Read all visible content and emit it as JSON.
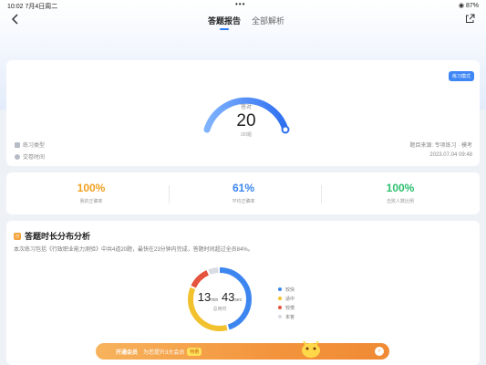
{
  "status_bar": {
    "time": "10:02",
    "date": "7月4日周二",
    "dots": "•••",
    "right": "◉ 87%"
  },
  "nav": {
    "back_icon": "chevron-left",
    "share_icon": "share",
    "tabs": [
      {
        "label": "答题报告",
        "active": true
      },
      {
        "label": "全部解析",
        "active": false
      }
    ]
  },
  "summary": {
    "tag": "练习模式",
    "gauge_label": "答对",
    "correct": "20",
    "total_text": "/20题",
    "fraction_correct": 1.0,
    "meta": {
      "type_label": "练习类型",
      "time_label": "交卷时间",
      "right_top": "题目来源: 专项练习 · 模考",
      "right_bottom": "2023.07.04 09:48"
    }
  },
  "stats": [
    {
      "value": "100%",
      "label": "我的正确率",
      "color": "#f0a020"
    },
    {
      "value": "61%",
      "label": "平均正确率",
      "color": "#3d86f0"
    },
    {
      "value": "100%",
      "label": "击败人数比例",
      "color": "#2cbf6f"
    }
  ],
  "time_analysis": {
    "title": "答题时长分布分析",
    "description": "本次练习包括《行政职业能力测验》中共4道20题，最快在23分钟内完成，答题时间超过全员84%。",
    "minutes": "13",
    "min_unit": "min",
    "seconds": "43",
    "sec_unit": "sec",
    "sub": "总用时",
    "legend": [
      {
        "label": "较快",
        "color": "#3d86f0",
        "value": 0.46
      },
      {
        "label": "适中",
        "color": "#f2c12e",
        "value": 0.36
      },
      {
        "label": "较慢",
        "color": "#e5533d",
        "value": 0.12
      },
      {
        "label": "未答",
        "color": "#d9dce3",
        "value": 0.06
      }
    ]
  },
  "promo": {
    "label": "开通会员",
    "text": "为您提升3大会员",
    "badge": "特惠",
    "arrow_icon": "chevron-right"
  }
}
